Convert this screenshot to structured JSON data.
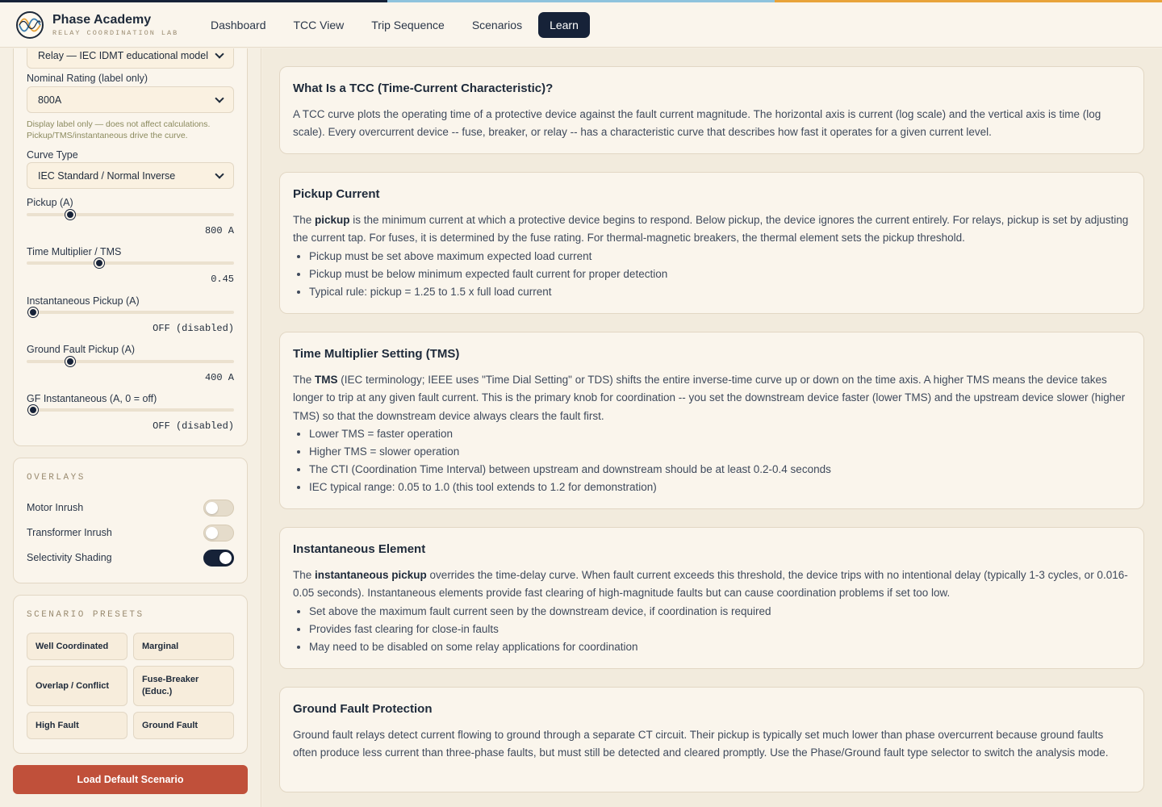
{
  "colors": {
    "accent_navy": "#162238",
    "accent_blue": "#8ec3dd",
    "accent_orange": "#e8a33a",
    "button_red": "#c0503a",
    "background": "#f5efe3"
  },
  "brand": {
    "name": "Phase Academy",
    "subtitle": "RELAY COORDINATION LAB",
    "logo_icon": "sine-wave-logo"
  },
  "nav": {
    "items": [
      {
        "label": "Dashboard",
        "active": false
      },
      {
        "label": "TCC View",
        "active": false
      },
      {
        "label": "Trip Sequence",
        "active": false
      },
      {
        "label": "Scenarios",
        "active": false
      },
      {
        "label": "Learn",
        "active": true
      }
    ]
  },
  "sidebar": {
    "device_model": {
      "value": "Relay — IEC IDMT educational model"
    },
    "nominal_rating": {
      "label": "Nominal Rating (label only)",
      "value": "800A",
      "hint": "Display label only — does not affect calculations. Pickup/TMS/instantaneous drive the curve."
    },
    "curve_type": {
      "label": "Curve Type",
      "value": "IEC Standard / Normal Inverse"
    },
    "sliders": [
      {
        "label": "Pickup (A)",
        "value": "800 A",
        "level": 0.21
      },
      {
        "label": "Time Multiplier / TMS",
        "value": "0.45",
        "level": 0.35
      },
      {
        "label": "Instantaneous Pickup (A)",
        "value": "OFF (disabled)",
        "level": 0.03
      },
      {
        "label": "Ground Fault Pickup (A)",
        "value": "400 A",
        "level": 0.21
      },
      {
        "label": "GF Instantaneous (A, 0 = off)",
        "value": "OFF (disabled)",
        "level": 0.03
      }
    ],
    "overlays": {
      "title": "OVERLAYS",
      "toggles": [
        {
          "label": "Motor Inrush",
          "on": false
        },
        {
          "label": "Transformer Inrush",
          "on": false
        },
        {
          "label": "Selectivity Shading",
          "on": true
        }
      ]
    },
    "presets": {
      "title": "SCENARIO PRESETS",
      "buttons": [
        "Well Coordinated",
        "Marginal",
        "Overlap / Conflict",
        "Fuse-Breaker (Educ.)",
        "High Fault",
        "Ground Fault"
      ]
    },
    "load_default_label": "Load Default Scenario"
  },
  "main": {
    "cards": [
      {
        "title": "What Is a TCC (Time-Current Characteristic)?",
        "body_parts": [
          "A TCC curve plots the operating time of a protective device against the fault current magnitude. The horizontal axis is current (log scale) and the vertical axis is time (log scale). Every overcurrent device -- fuse, breaker, or relay -- has a characteristic curve that describes how fast it operates for a given current level."
        ],
        "bullets": []
      },
      {
        "title": "Pickup Current",
        "body_parts": [
          "The ",
          "pickup",
          " is the minimum current at which a protective device begins to respond. Below pickup, the device ignores the current entirely. For relays, pickup is set by adjusting the current tap. For fuses, it is determined by the fuse rating. For thermal-magnetic breakers, the thermal element sets the pickup threshold."
        ],
        "bullets": [
          "Pickup must be set above maximum expected load current",
          "Pickup must be below minimum expected fault current for proper detection",
          "Typical rule: pickup = 1.25 to 1.5 x full load current"
        ]
      },
      {
        "title": "Time Multiplier Setting (TMS)",
        "body_parts": [
          "The ",
          "TMS",
          " (IEC terminology; IEEE uses \"Time Dial Setting\" or TDS) shifts the entire inverse-time curve up or down on the time axis. A higher TMS means the device takes longer to trip at any given fault current. This is the primary knob for coordination -- you set the downstream device faster (lower TMS) and the upstream device slower (higher TMS) so that the downstream device always clears the fault first."
        ],
        "bullets": [
          "Lower TMS = faster operation",
          "Higher TMS = slower operation",
          "The CTI (Coordination Time Interval) between upstream and downstream should be at least 0.2-0.4 seconds",
          "IEC typical range: 0.05 to 1.0 (this tool extends to 1.2 for demonstration)"
        ]
      },
      {
        "title": "Instantaneous Element",
        "body_parts": [
          "The ",
          "instantaneous pickup",
          " overrides the time-delay curve. When fault current exceeds this threshold, the device trips with no intentional delay (typically 1-3 cycles, or 0.016-0.05 seconds). Instantaneous elements provide fast clearing of high-magnitude faults but can cause coordination problems if set too low."
        ],
        "bullets": [
          "Set above the maximum fault current seen by the downstream device, if coordination is required",
          "Provides fast clearing for close-in faults",
          "May need to be disabled on some relay applications for coordination"
        ]
      },
      {
        "title": "Ground Fault Protection",
        "body_parts": [
          "Ground fault relays detect current flowing to ground through a separate CT circuit. Their pickup is typically set much lower than phase overcurrent because ground faults often produce less current than three-phase faults, but must still be detected and cleared promptly. Use the Phase/Ground fault type selector to switch the analysis mode."
        ],
        "bullets": []
      }
    ]
  }
}
